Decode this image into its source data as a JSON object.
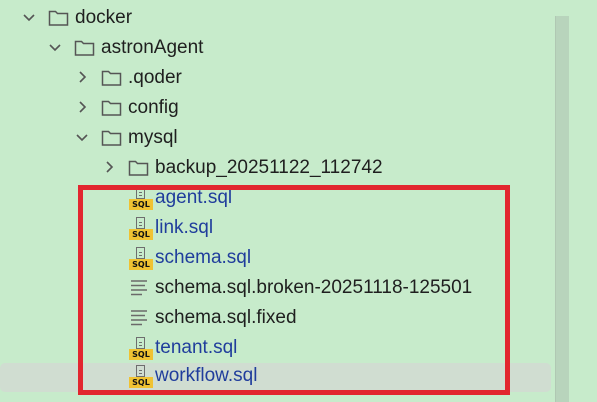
{
  "tree": {
    "items": [
      {
        "label": "docker",
        "type": "folder",
        "expanded": true,
        "icon": "folder-icon"
      },
      {
        "label": "astronAgent",
        "type": "folder",
        "expanded": true,
        "icon": "folder-icon"
      },
      {
        "label": ".qoder",
        "type": "folder",
        "expanded": false,
        "icon": "folder-icon"
      },
      {
        "label": "config",
        "type": "folder",
        "expanded": false,
        "icon": "folder-icon"
      },
      {
        "label": "mysql",
        "type": "folder",
        "expanded": true,
        "icon": "folder-icon"
      },
      {
        "label": "backup_20251122_112742",
        "type": "folder",
        "expanded": false,
        "icon": "folder-icon"
      },
      {
        "label": "agent.sql",
        "type": "sql",
        "icon": "sql-file-icon",
        "badge": "SQL"
      },
      {
        "label": "link.sql",
        "type": "sql",
        "icon": "sql-file-icon",
        "badge": "SQL"
      },
      {
        "label": "schema.sql",
        "type": "sql",
        "icon": "sql-file-icon",
        "badge": "SQL"
      },
      {
        "label": "schema.sql.broken-20251118-125501",
        "type": "text",
        "icon": "text-file-icon"
      },
      {
        "label": "schema.sql.fixed",
        "type": "text",
        "icon": "text-file-icon"
      },
      {
        "label": "tenant.sql",
        "type": "sql",
        "icon": "sql-file-icon",
        "badge": "SQL"
      },
      {
        "label": "workflow.sql",
        "type": "sql",
        "icon": "sql-file-icon",
        "badge": "SQL",
        "selected": true
      }
    ]
  },
  "colors": {
    "background": "#c7ebcb",
    "selection": "#d0ddd1",
    "sql_text": "#203d9c",
    "folder_text": "#1f1f1f",
    "annotation_border": "#e2262f",
    "sql_badge": "#f0c232"
  }
}
